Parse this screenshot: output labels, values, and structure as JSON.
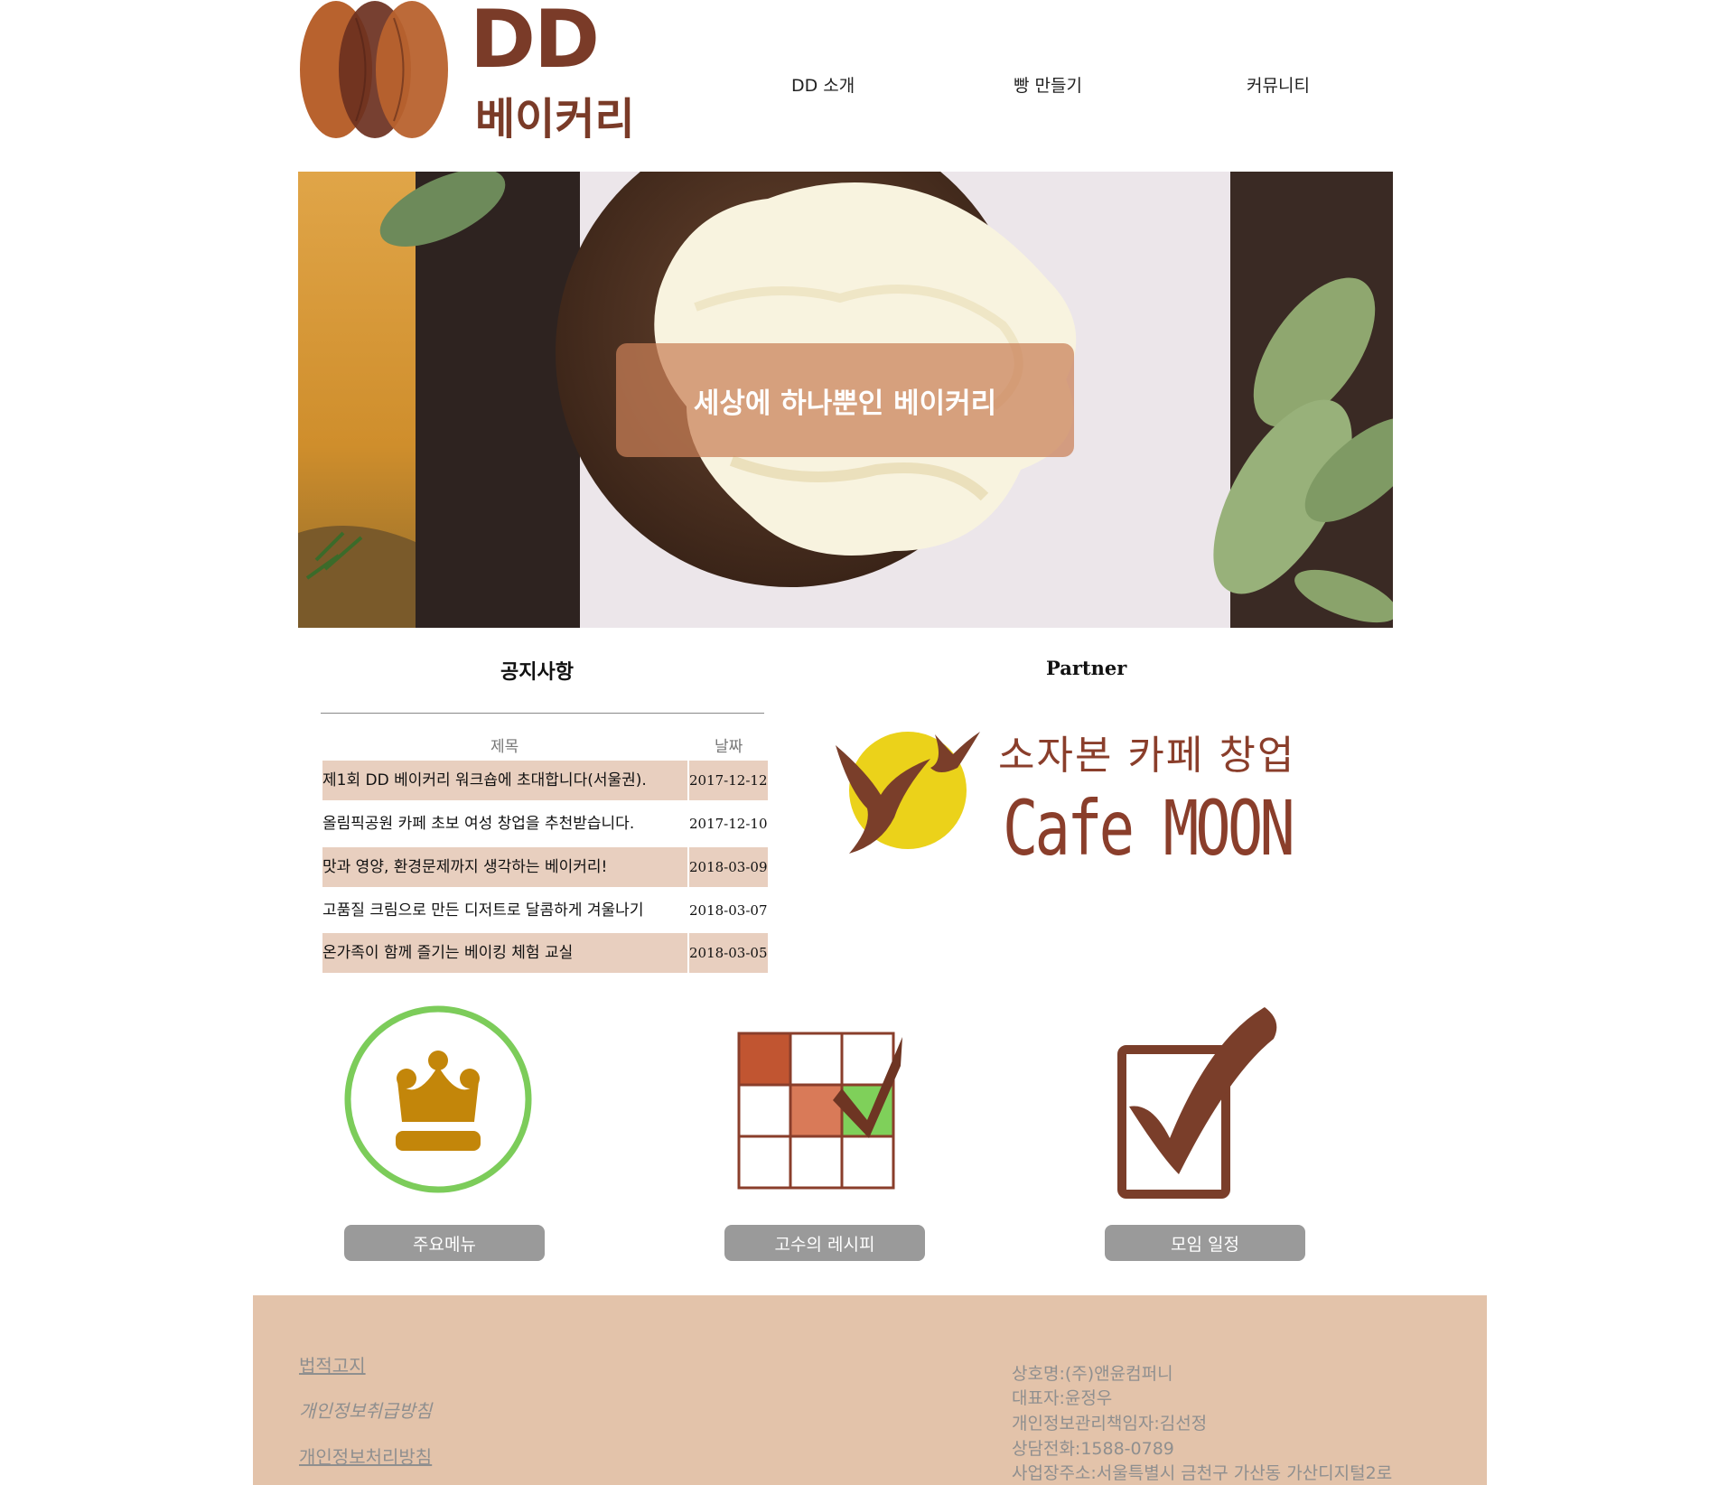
{
  "header": {
    "logo": {
      "line1": "DD",
      "line2": "베이커리"
    },
    "nav": [
      "DD 소개",
      "빵 만들기",
      "커뮤니티"
    ]
  },
  "hero": {
    "caption": "세상에 하나뿐인 베이커리"
  },
  "notice": {
    "title": "공지사항",
    "columns": [
      "제목",
      "날짜"
    ],
    "rows": [
      {
        "title": "제1회 DD 베이커리 워크숍에 초대합니다(서울권).",
        "date": "2017-12-12"
      },
      {
        "title": "올림픽공원 카페 초보 여성 창업을 추천받습니다.",
        "date": "2017-12-10"
      },
      {
        "title": "맛과 영양, 환경문제까지 생각하는 베이커리!",
        "date": "2018-03-09"
      },
      {
        "title": "고품질 크림으로 만든 디저트로 달콤하게 겨울나기",
        "date": "2018-03-07"
      },
      {
        "title": "온가족이 함께 즐기는 베이킹 체험 교실",
        "date": "2018-03-05"
      }
    ]
  },
  "partner": {
    "title": "Partner",
    "logo_line1": "소자본 카페 창업",
    "logo_line2": "Cafe MOON"
  },
  "features": [
    {
      "label": "주요메뉴",
      "icon": "crown-icon"
    },
    {
      "label": "고수의 레시피",
      "icon": "grid-check-icon"
    },
    {
      "label": "모임 일정",
      "icon": "checkbox-icon"
    }
  ],
  "footer": {
    "links": [
      "법적고지",
      "개인정보취급방침",
      "개인정보처리방침"
    ],
    "info": [
      "상호명:(주)앤윤컴퍼니",
      "대표자:윤정우",
      "개인정보관리책임자:김선정",
      "상담전화:1588-0789",
      "사업장주소:서울특별시 금천구 가산동 가산디지털2로"
    ]
  },
  "colors": {
    "brand_brown": "#8a3e2b",
    "row_highlight": "#e8cfbf",
    "footer_bg": "#e3c3aa",
    "button_gray": "#9a9a9a",
    "icon_green": "#7ccc5a"
  }
}
